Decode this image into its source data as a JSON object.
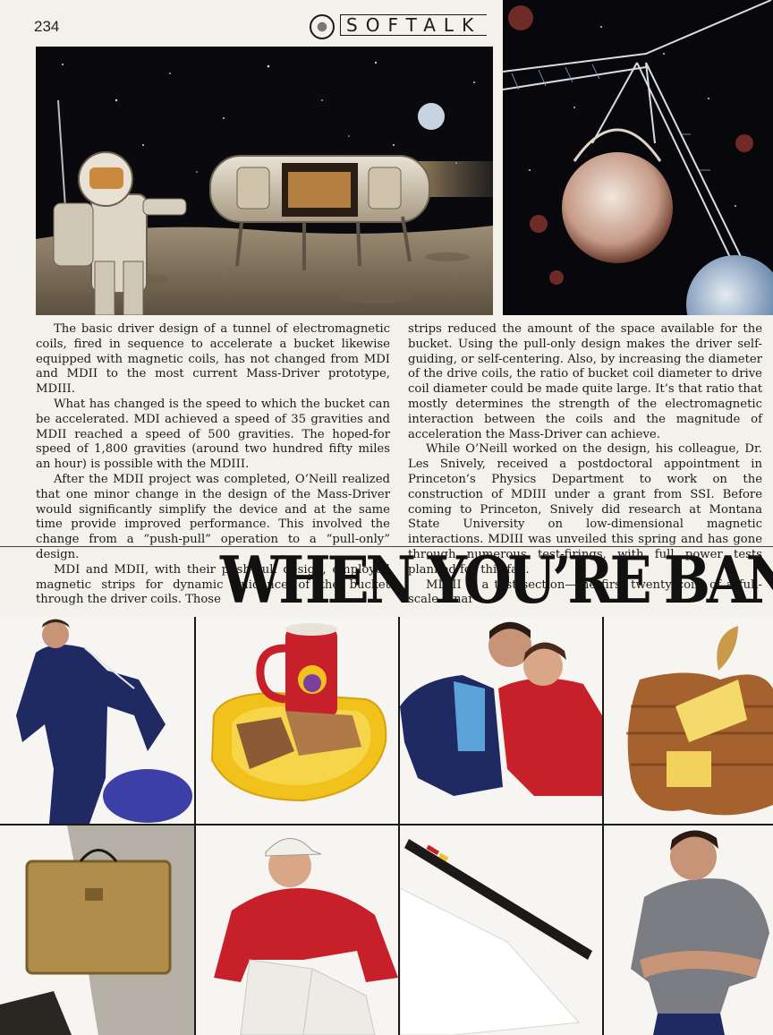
{
  "header": {
    "page_number": "234",
    "magazine_name": "SOFTALK"
  },
  "article": {
    "left_column": [
      "The basic driver design of a tunnel of electromagnetic coils, fired in sequence to accelerate a bucket likewise equipped with magnetic coils, has not changed from MDI and MDII to the most current Mass-Driver prototype, MDIII.",
      "What has changed is the speed to which the bucket can be accel­erated. MDI achieved a speed of 35 gravities and MDII reached a speed of 500 gravities. The hoped-for speed of 1,800 gravities (around two hun­dred fifty miles an hour) is possible with the MDIII.",
      "After the MDII project was completed, O’Neill realized that one minor change in the design of the Mass-Driver would significantly sim­plify the device and at the same time provide improved performance. This involved the change from a “push-pull” operation to a “pull-only” design.",
      "MDI and MDII, with their push-pull design, employed magnetic strips for dynamic guidance of the bucket through the driver coils. Those"
    ],
    "right_column": [
      "strips reduced the amount of the space available for the bucket. Using the pull-only design makes the driver self-guiding, or self-centering. Also, by increasing the diameter of the drive coils, the ratio of bucket coil diam­eter to drive coil diameter could be made quite large. It’s that ratio that mostly determines the strength of the electromagnetic interaction be­tween the coils and the magnitude of acceleration the Mass-Driver can achieve.",
      "While O’Neill worked on the design, his colleague, Dr. Les Snively, received a postdoctoral appointment in Princeton’s Physics Depart­ment to work on the construction of MDIII under a grant from SSI. Be­fore coming to Princeton, Snively did research at Montana State Uni­versity on low-dimensional magnetic interactions. MDIII was unveiled this spring and has gone through numerous test-firings, with full power tests planned for this fall.",
      "MDIII is a test section—the first twenty coils of a full-scale lunar"
    ]
  },
  "ad": {
    "headline": "WHEN YOU’RE BAN"
  },
  "colors": {
    "paper": "#f4f1ea",
    "ink": "#1b1a18",
    "navy": "#1c2b5a",
    "apple_red": "#c8202a",
    "tray_yellow": "#f1c21b"
  }
}
